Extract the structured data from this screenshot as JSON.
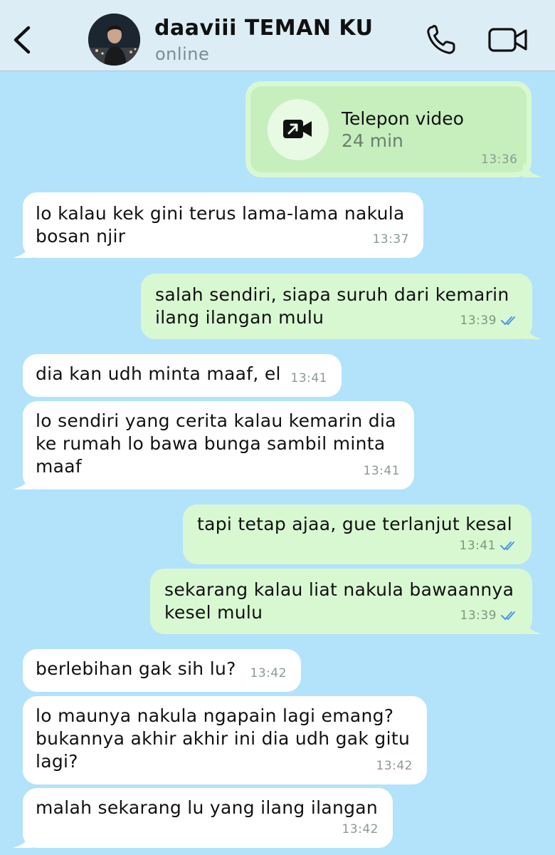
{
  "header": {
    "contact_name": "daaviii TEMAN KU",
    "status": "online",
    "icons": [
      "back-chevron-icon",
      "phone-icon",
      "video-camera-icon"
    ]
  },
  "call_card": {
    "title": "Telepon video",
    "duration": "24 min",
    "time": "13:36",
    "icon": "outgoing-video-call-icon"
  },
  "messages": [
    {
      "direction": "in",
      "text": "lo kalau kek gini terus lama-lama nakula\nbosan njir",
      "time": "13:37"
    },
    {
      "direction": "out",
      "text": "salah sendiri, siapa suruh dari kemarin\nilang ilangan mulu",
      "time": "13:39",
      "read": true
    },
    {
      "direction": "in",
      "text": "dia kan udh minta maaf, el",
      "time": "13:41"
    },
    {
      "direction": "in",
      "text": "lo sendiri yang cerita kalau kemarin dia\nke rumah lo bawa bunga sambil minta\nmaaf",
      "time": "13:41"
    },
    {
      "direction": "out",
      "text": "tapi tetap ajaa, gue terlanjut kesal",
      "time": "13:41",
      "read": true
    },
    {
      "direction": "out",
      "text": "sekarang kalau liat nakula bawaannya\nkesel mulu",
      "time": "13:39",
      "read": true
    },
    {
      "direction": "in",
      "text": "berlebihan gak sih lu?",
      "time": "13:42"
    },
    {
      "direction": "in",
      "text": "lo maunya nakula ngapain lagi emang?\nbukannya akhir akhir ini dia udh gak gitu\nlagi?",
      "time": "13:42"
    },
    {
      "direction": "in",
      "text": "malah sekarang lu yang ilang ilangan",
      "time": "13:42"
    }
  ],
  "colors": {
    "background": "#b3e2fb",
    "header": "#dcedf6",
    "incoming_bubble": "#ffffff",
    "outgoing_bubble": "#d8f8d2",
    "read_ticks": "#4d97e8"
  }
}
